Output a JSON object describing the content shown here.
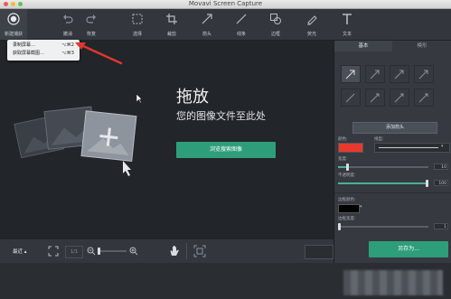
{
  "window": {
    "title": "Movavi Screen Capture"
  },
  "toolbar": {
    "tools": [
      {
        "id": "capture",
        "label": "新建捕获",
        "icon": "record-icon"
      },
      {
        "id": "undo",
        "label": "撤消",
        "icon": "undo-icon"
      },
      {
        "id": "redo",
        "label": "恢复",
        "icon": "redo-icon"
      },
      {
        "id": "select",
        "label": "选择",
        "icon": "select-icon"
      },
      {
        "id": "crop",
        "label": "裁剪",
        "icon": "crop-icon"
      },
      {
        "id": "arrow",
        "label": "箭头",
        "icon": "arrow-icon"
      },
      {
        "id": "line",
        "label": "线条",
        "icon": "line-icon"
      },
      {
        "id": "shape",
        "label": "边框",
        "icon": "shape-icon"
      },
      {
        "id": "highlight",
        "label": "荧光",
        "icon": "highlighter-icon"
      },
      {
        "id": "text",
        "label": "文本",
        "icon": "text-icon"
      }
    ]
  },
  "capture_menu": {
    "items": [
      {
        "label": "录制屏幕…",
        "shortcut": "⌥⌘2"
      },
      {
        "label": "获取屏幕截图…",
        "shortcut": "⌥⌘3"
      }
    ]
  },
  "canvas": {
    "heading": "拖放",
    "subheading": "您的图像文件至此处",
    "browse_label": "浏览搜索图像"
  },
  "panel": {
    "tabs": [
      "基本",
      "模形"
    ],
    "add_arrow_label": "添加箭头",
    "color_label": "颜色:",
    "line_label": "线型:",
    "width_label": "宽度:",
    "width_value": "10",
    "opacity_label": "不透明度:",
    "opacity_value": "100",
    "border_color_label": "边框颜色:",
    "border_width_label": "边框宽度:",
    "border_width_value": "1",
    "color_value": "#e8392e",
    "border_color_value": "#000000",
    "save_label": "另存为...",
    "width_fraction": 0.1,
    "opacity_fraction": 1.0
  },
  "bottombar": {
    "recent_label": "最近",
    "zoom_actual": "1/1"
  },
  "colors": {
    "accent": "#2e9e7a",
    "annotation_arrow": "#e0382c"
  }
}
